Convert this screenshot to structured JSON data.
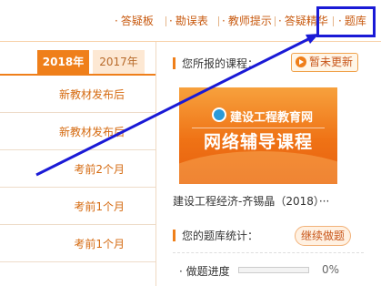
{
  "nav": {
    "items": [
      {
        "label": "答疑板"
      },
      {
        "label": "勘误表"
      },
      {
        "label": "教师提示"
      },
      {
        "label": "答疑精华"
      },
      {
        "label": "题库"
      }
    ]
  },
  "years": {
    "active": "2018年",
    "inactive": "2017年"
  },
  "list": {
    "items": [
      {
        "label": "新教材发布后"
      },
      {
        "label": "新教材发布后"
      },
      {
        "label": "考前2个月"
      },
      {
        "label": "考前1个月"
      },
      {
        "label": "考前1个月"
      }
    ]
  },
  "course": {
    "section_title": "您所报的课程：",
    "update_button": "暂未更新",
    "banner_logo_text": "建设工程教育网",
    "banner_title": "网络辅导课程",
    "name": "建设工程经济-齐锡晶（2018）···"
  },
  "stats": {
    "section_title": "您的题库统计：",
    "continue_button": "继续做题",
    "progress_label": "· 做题进度",
    "progress_value": 0,
    "progress_percent": "0%"
  },
  "colors": {
    "accent": "#ef7f1a",
    "link": "#c85a10",
    "annotation": "#1a1ad6"
  }
}
